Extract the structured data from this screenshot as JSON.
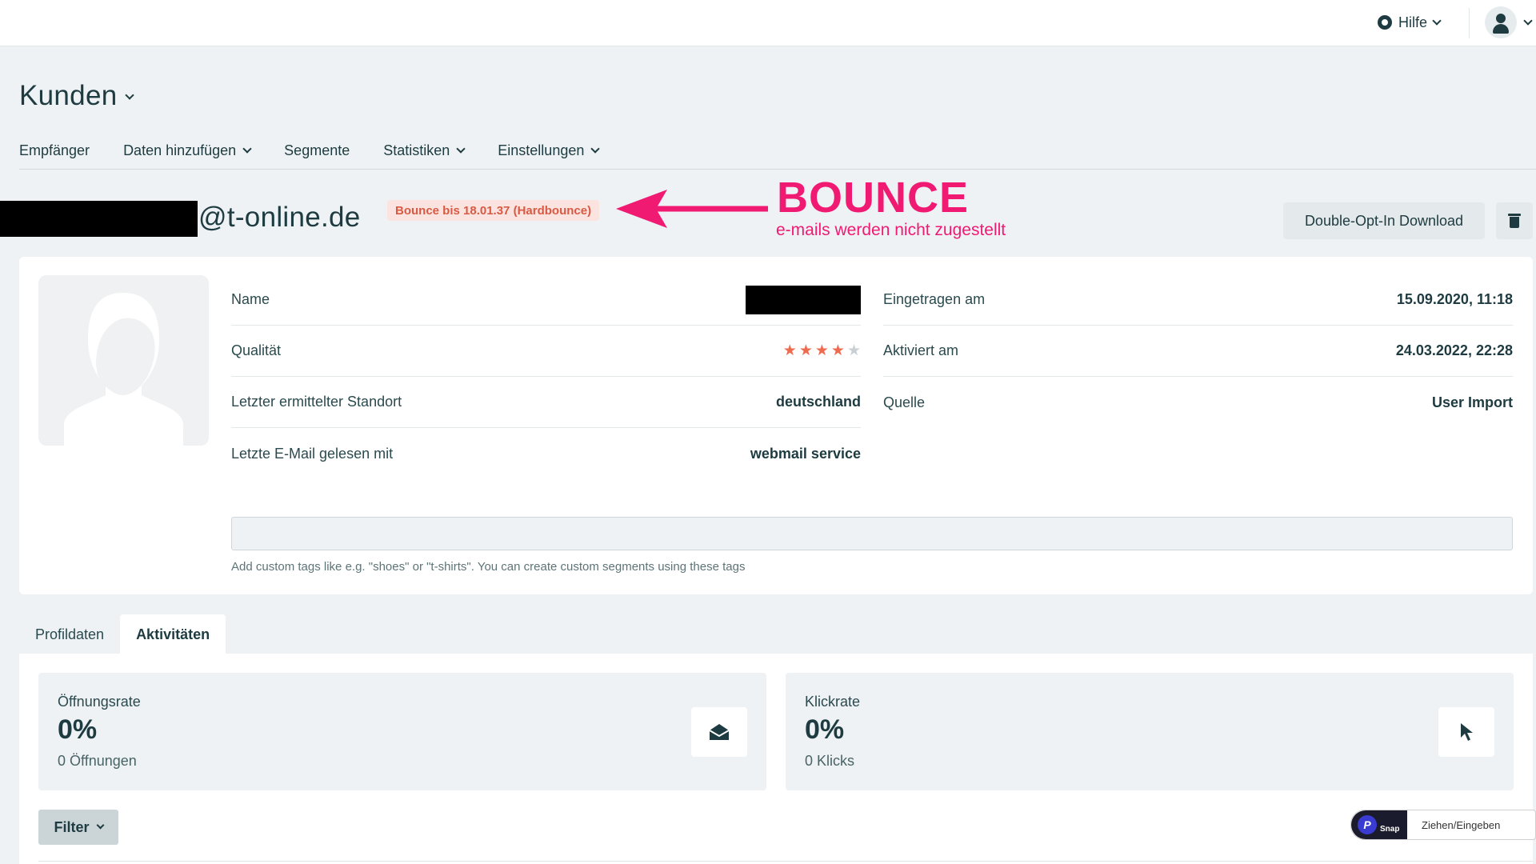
{
  "topbar": {
    "help_label": "Hilfe"
  },
  "page": {
    "title": "Kunden"
  },
  "subnav": [
    {
      "label": "Empfänger"
    },
    {
      "label": "Daten hinzufügen"
    },
    {
      "label": "Segmente"
    },
    {
      "label": "Statistiken"
    },
    {
      "label": "Einstellungen"
    }
  ],
  "contact": {
    "email_domain": "@t-online.de",
    "bounce_badge": "Bounce bis 18.01.37 (Hardbounce)"
  },
  "annotation": {
    "title": "BOUNCE",
    "subtitle": "e-mails werden nicht zugestellt"
  },
  "actions": {
    "doi_download": "Double-Opt-In Download"
  },
  "profile": {
    "name_label": "Name",
    "quality_label": "Qualität",
    "quality_stars": 4,
    "quality_max": 5,
    "location_label": "Letzter ermittelter Standort",
    "location_value": "deutschland",
    "last_read_label": "Letzte E-Mail gelesen mit",
    "last_read_value": "webmail service",
    "registered_label": "Eingetragen am",
    "registered_value": "15.09.2020, 11:18",
    "activated_label": "Aktiviert am",
    "activated_value": "24.03.2022, 22:28",
    "source_label": "Quelle",
    "source_value": "User Import"
  },
  "tags": {
    "value": "",
    "hint": "Add custom tags like e.g. \"shoes\" or \"t-shirts\". You can create custom segments using these tags"
  },
  "tabs": [
    {
      "label": "Profildaten"
    },
    {
      "label": "Aktivitäten"
    }
  ],
  "stats": {
    "open_label": "Öffnungsrate",
    "open_value": "0%",
    "open_sub": "0 Öffnungen",
    "click_label": "Klickrate",
    "click_value": "0%",
    "click_sub": "0 Klicks"
  },
  "filter_label": "Filter",
  "snap": {
    "text": "Ziehen/Eingeben",
    "badge": "Snap"
  },
  "colors": {
    "accent_pink": "#f01a73",
    "star_on": "#ef6b50",
    "dark": "#1d3b40"
  }
}
